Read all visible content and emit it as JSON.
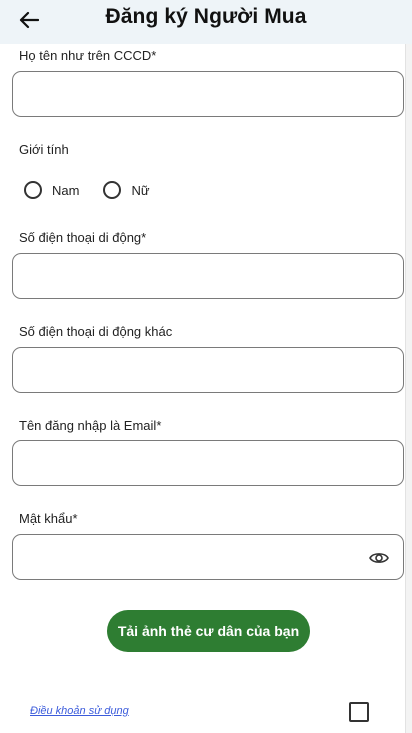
{
  "header": {
    "title": "Đăng ký Người Mua",
    "back_icon": "arrow-left-icon"
  },
  "form": {
    "full_name": {
      "label": "Họ tên như trên CCCD*",
      "value": "",
      "placeholder": ""
    },
    "gender": {
      "label": "Giới tính",
      "options": [
        {
          "label": "Nam",
          "selected": false
        },
        {
          "label": "Nữ",
          "selected": false
        }
      ]
    },
    "phone": {
      "label": "Số điện thoại di động*",
      "value": "",
      "placeholder": ""
    },
    "phone_alt": {
      "label": "Số điện thoại di động khác",
      "value": "",
      "placeholder": ""
    },
    "username_email": {
      "label": "Tên đăng nhập là Email*",
      "value": "",
      "placeholder": ""
    },
    "password": {
      "label": "Mật khẩu*",
      "value": "",
      "placeholder": "",
      "toggle_icon": "eye-icon"
    }
  },
  "upload_button": {
    "label": "Tải ảnh thẻ cư dân của bạn"
  },
  "terms": {
    "link_text": "Điều khoản sử dụng",
    "checked": false
  },
  "colors": {
    "appbar_bg": "#eef4f8",
    "primary_button": "#2e7d32",
    "link": "#3b5bdb",
    "field_border": "#7a7a7a"
  }
}
